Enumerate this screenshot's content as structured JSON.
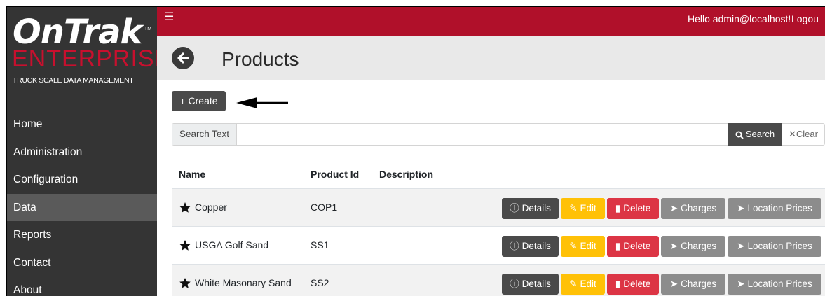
{
  "logo": {
    "main": "OnTrak",
    "tm": "TM",
    "sub": "ENTERPRISE",
    "tagline": "TRUCK SCALE DATA MANAGEMENT"
  },
  "sidebar": {
    "items": [
      {
        "label": "Home"
      },
      {
        "label": "Administration"
      },
      {
        "label": "Configuration"
      },
      {
        "label": "Data"
      },
      {
        "label": "Reports"
      },
      {
        "label": "Contact"
      },
      {
        "label": "About"
      }
    ],
    "active": "Data"
  },
  "topbar": {
    "menu_icon": "hamburger-icon",
    "greeting": "Hello admin@localhost!",
    "logout": "Logou"
  },
  "header": {
    "title": "Products",
    "back_icon": "arrow-left-circle-icon"
  },
  "toolbar": {
    "create_label": "+ Create"
  },
  "search": {
    "label": "Search Text",
    "value": "",
    "placeholder": "",
    "search_label": "Search",
    "clear_label": "Clear"
  },
  "table": {
    "columns": [
      "Name",
      "Product Id",
      "Description"
    ],
    "rows": [
      {
        "name": "Copper",
        "product_id": "COP1",
        "description": ""
      },
      {
        "name": "USGA Golf Sand",
        "product_id": "SS1",
        "description": ""
      },
      {
        "name": "White Masonary Sand",
        "product_id": "SS2",
        "description": ""
      }
    ],
    "actions": {
      "details": "Details",
      "edit": "Edit",
      "delete": "Delete",
      "charges": "Charges",
      "location_prices": "Location Prices"
    }
  },
  "colors": {
    "brand_red": "#b0102a",
    "sidebar": "#343434",
    "warning": "#ffc107",
    "danger": "#dc3545",
    "secondary": "#8c8c8c",
    "dark": "#4a4a4a"
  }
}
